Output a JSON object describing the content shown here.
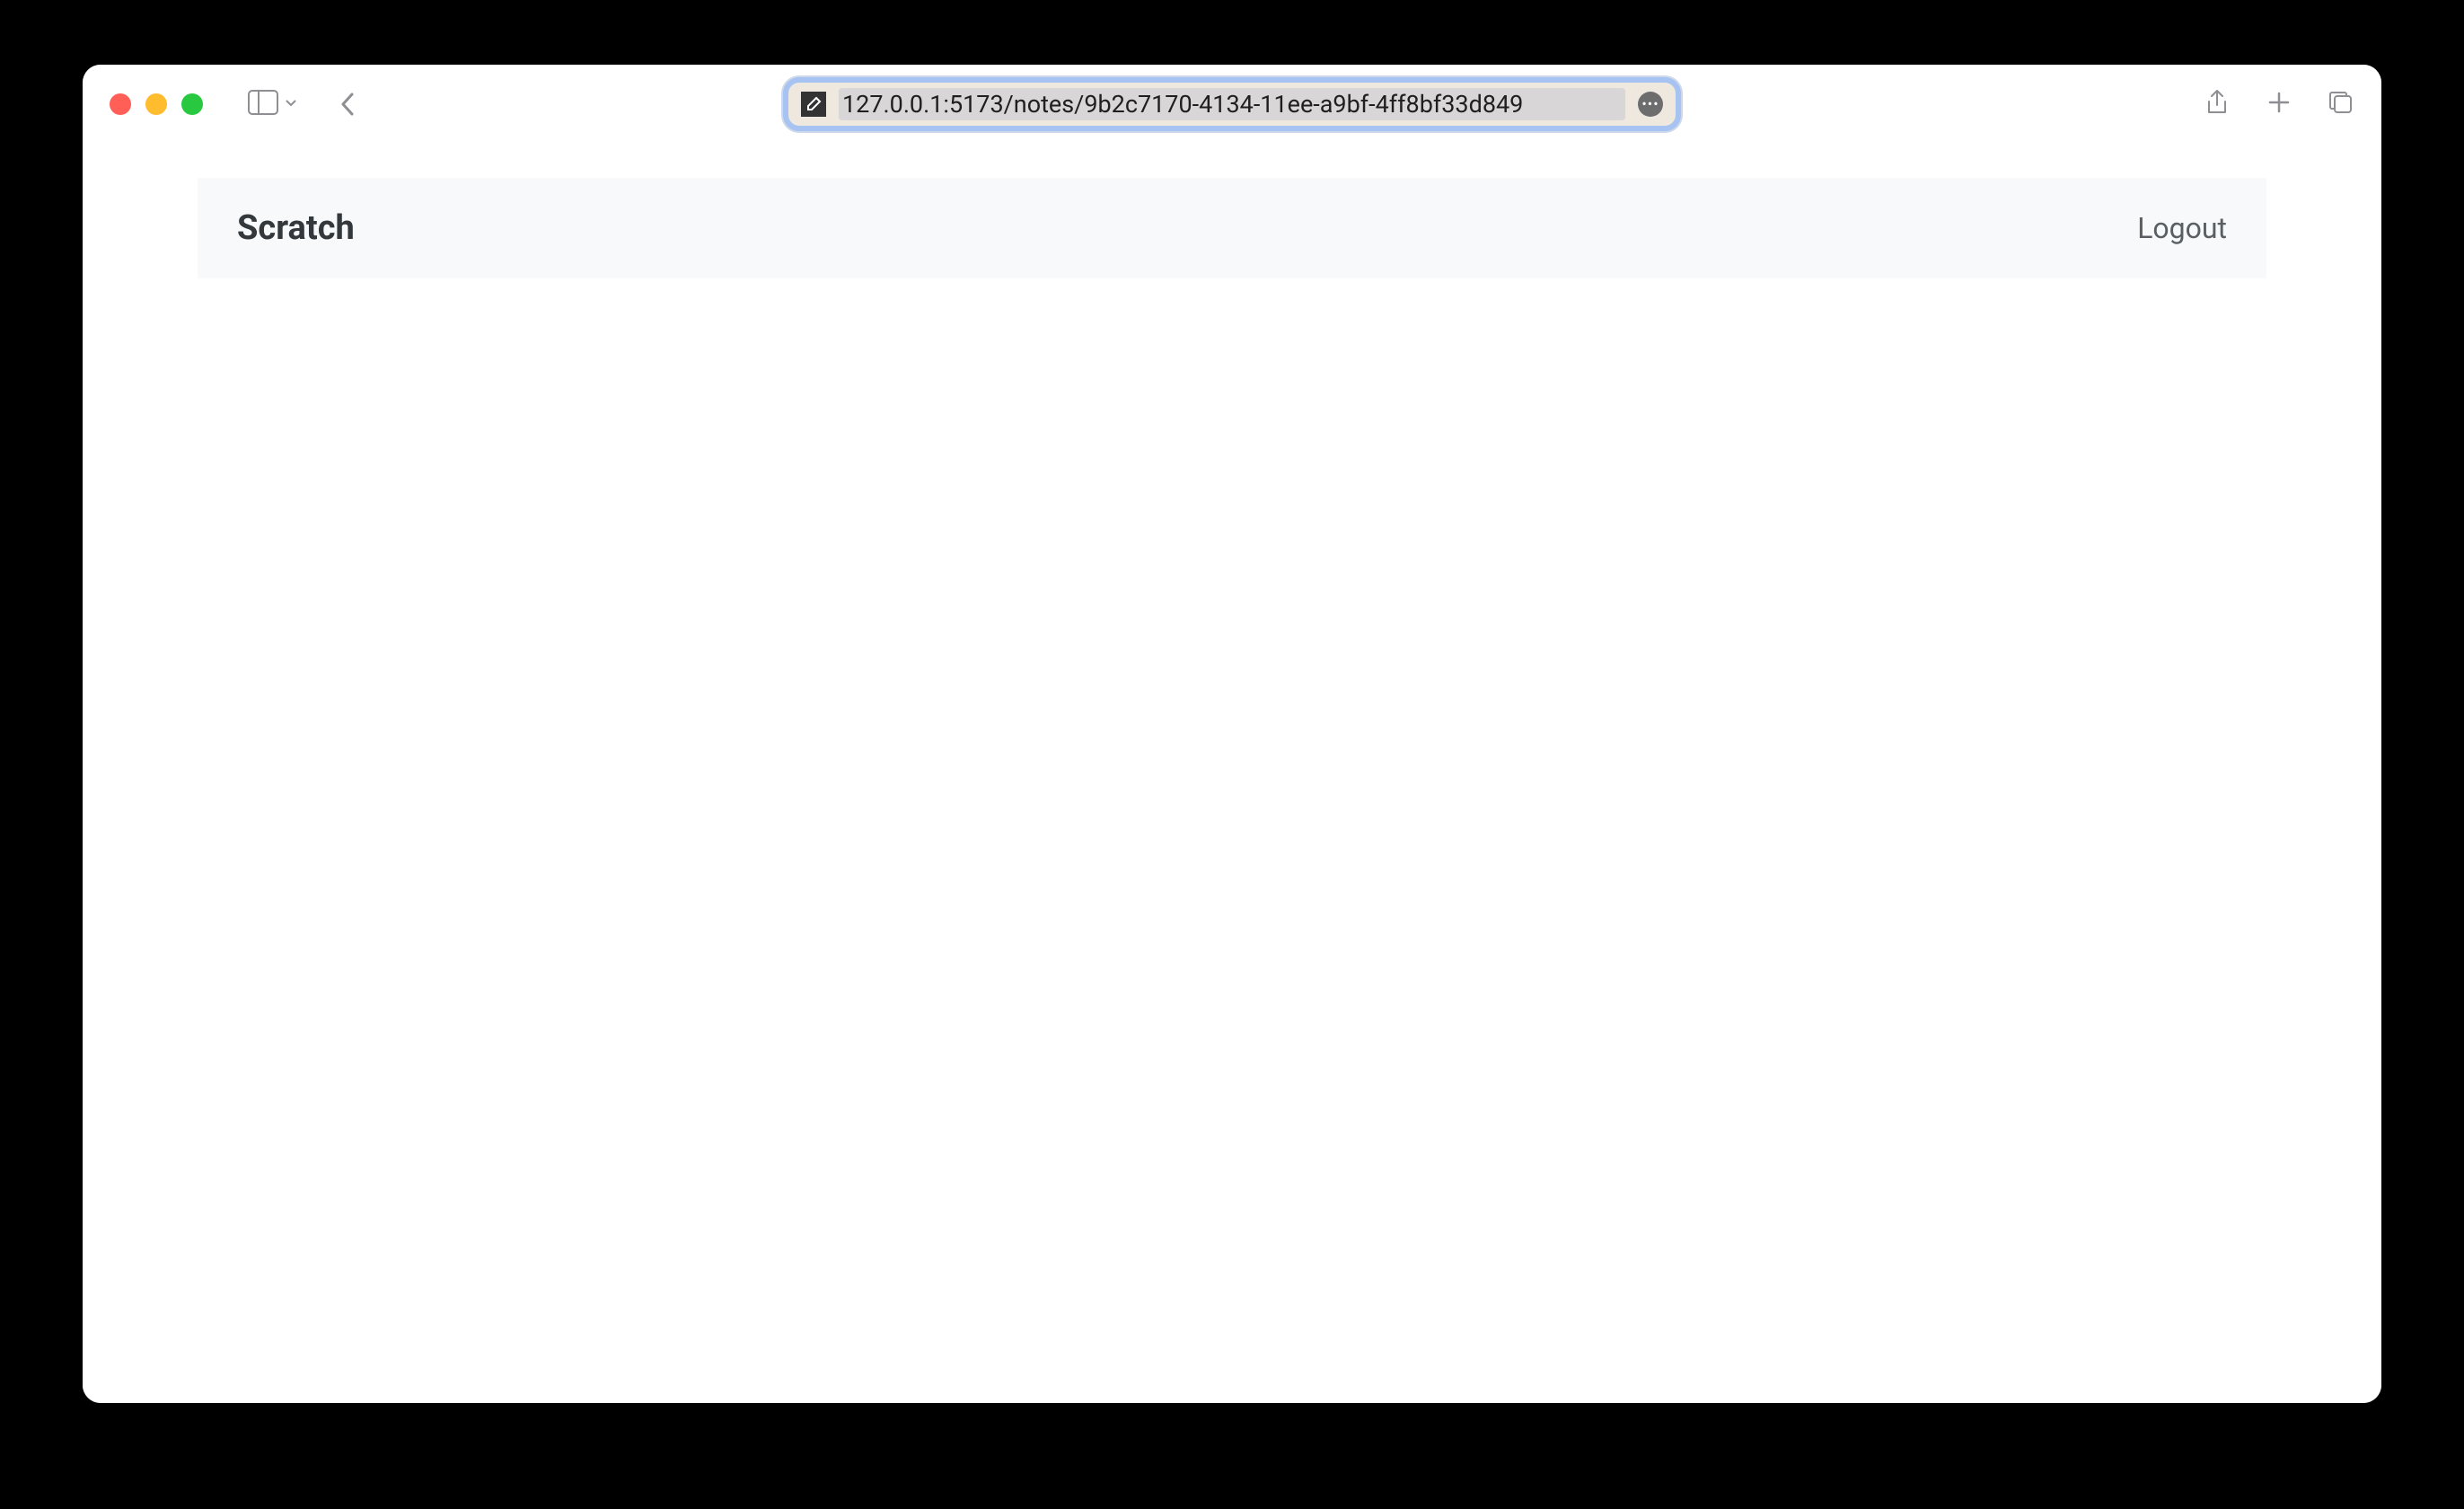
{
  "browser": {
    "url": "127.0.0.1:5173/notes/9b2c7170-4134-11ee-a9bf-4ff8bf33d849"
  },
  "app": {
    "title": "Scratch",
    "logout_label": "Logout"
  }
}
